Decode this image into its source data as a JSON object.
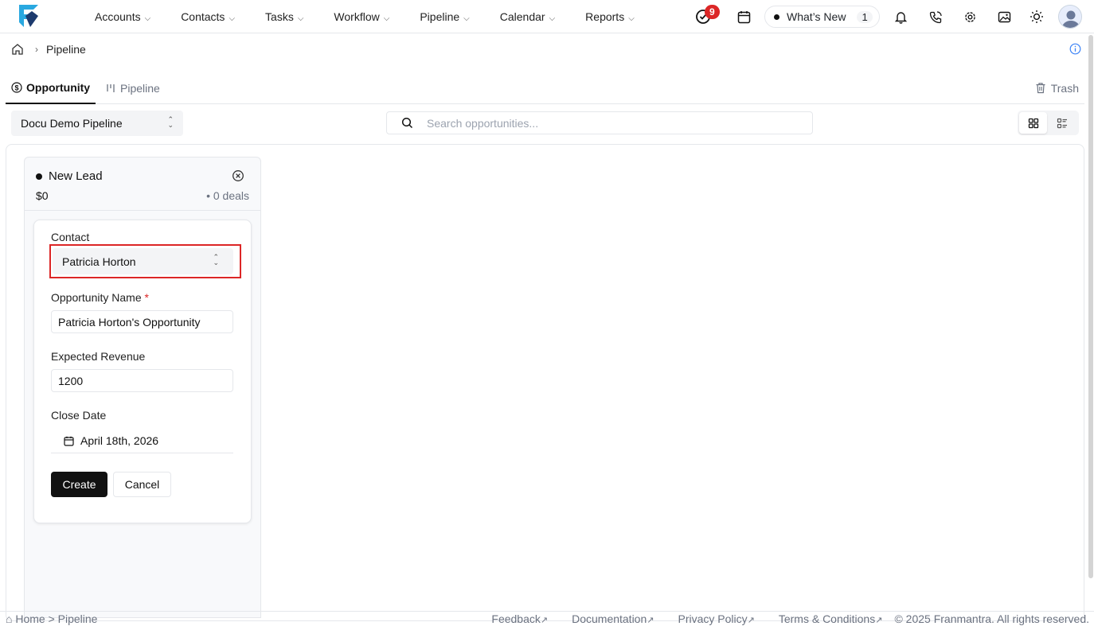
{
  "nav": {
    "items": [
      {
        "label": "Accounts"
      },
      {
        "label": "Contacts"
      },
      {
        "label": "Tasks"
      },
      {
        "label": "Workflow"
      },
      {
        "label": "Pipeline"
      },
      {
        "label": "Calendar"
      },
      {
        "label": "Reports"
      }
    ],
    "notification_count": "9",
    "whats_new_label": "What’s New",
    "whats_new_count": "1"
  },
  "breadcrumb": {
    "current": "Pipeline"
  },
  "tabs": {
    "opportunity": "Opportunity",
    "pipeline": "Pipeline",
    "trash": "Trash"
  },
  "controls": {
    "pipeline_select": "Docu Demo Pipeline",
    "search_placeholder": "Search opportunities..."
  },
  "column": {
    "title": "New Lead",
    "amount": "$0",
    "deals": "• 0 deals"
  },
  "form": {
    "contact_label": "Contact",
    "contact_value": "Patricia Horton",
    "name_label": "Opportunity Name",
    "name_required": "*",
    "name_value": "Patricia Horton's Opportunity",
    "revenue_label": "Expected Revenue",
    "revenue_value": "1200",
    "date_label": "Close Date",
    "date_value": "April 18th, 2026",
    "create_label": "Create",
    "cancel_label": "Cancel"
  },
  "footer": {
    "breadcrumb": "⌂ Home > Pipeline",
    "links": [
      "Feedback",
      "Documentation",
      "Privacy Policy",
      "Terms & Conditions"
    ],
    "copyright": "© 2025 Franmantra. All rights reserved."
  },
  "colors": {
    "accent": "#111111",
    "highlight": "#dc2626",
    "logo": "#29a8e0"
  },
  "icons": [
    "logo",
    "tasks-check-icon",
    "calendar-icon",
    "bell-icon",
    "phone-icon",
    "gear-icon",
    "image-icon",
    "sun-icon",
    "avatar",
    "home-icon",
    "info-icon",
    "dollar-icon",
    "pipeline-icon",
    "trash-icon",
    "search-icon",
    "grid-view-icon",
    "list-view-icon",
    "close-circle-icon",
    "updown-icon",
    "external-link-icon"
  ]
}
